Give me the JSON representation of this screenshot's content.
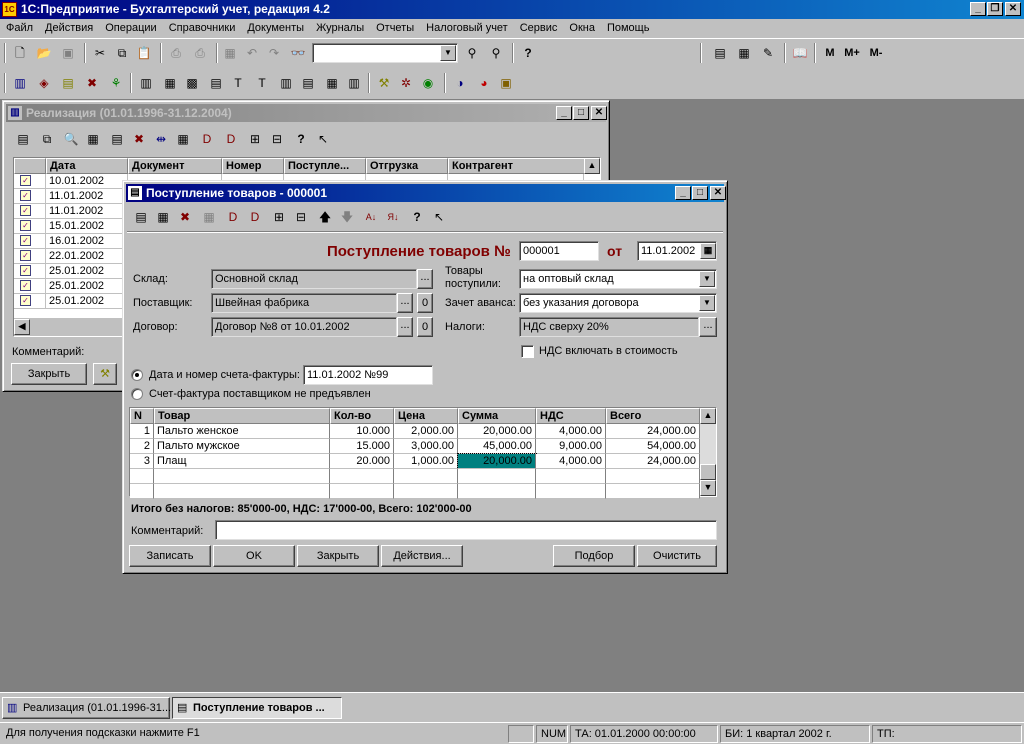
{
  "app": {
    "title": "1С:Предприятие - Бухгалтерский учет, редакция 4.2",
    "menu": [
      "Файл",
      "Действия",
      "Операции",
      "Справочники",
      "Документы",
      "Журналы",
      "Отчеты",
      "Налоговый учет",
      "Сервис",
      "Окна",
      "Помощь"
    ],
    "memory_buttons": [
      "M",
      "M+",
      "M-"
    ]
  },
  "realizacia": {
    "title": "Реализация (01.01.1996-31.12.2004)",
    "columns": [
      "Дата",
      "Документ",
      "Номер",
      "Поступле...",
      "Отгрузка",
      "Контрагент"
    ],
    "dates": [
      "10.01.2002",
      "11.01.2002",
      "11.01.2002",
      "15.01.2002",
      "16.01.2002",
      "22.01.2002",
      "25.01.2002",
      "25.01.2002",
      "25.01.2002"
    ],
    "comment_label": "Комментарий:",
    "close_button": "Закрыть"
  },
  "doc": {
    "window_title": "Поступление товаров - 000001",
    "heading": "Поступление товаров №",
    "number": "000001",
    "from_label": "от",
    "date": "11.01.2002",
    "sklad_label": "Склад:",
    "sklad_value": "Основной склад",
    "postavshik_label": "Поставщик:",
    "postavshik_value": "Швейная фабрика",
    "dogovor_label": "Договор:",
    "dogovor_value": "Договор №8 от 10.01.2002",
    "tovary_label_1": "Товары",
    "tovary_label_2": "поступили:",
    "tovary_value": "на оптовый склад",
    "zachet_label": "Зачет аванса:",
    "zachet_value": "без указания договора",
    "nalogi_label": "Налоги:",
    "nalogi_value": "НДС сверху 20%",
    "nds_checkbox_label": "НДС включать в стоимость",
    "radio1_label": "Дата и номер счета-фактуры:",
    "radio1_value": "11.01.2002 №99",
    "radio2_label": "Счет-фактура поставщиком не предъявлен",
    "ellipsis": "...",
    "zero": "0",
    "table": {
      "columns": [
        "N",
        "Товар",
        "Кол-во",
        "Цена",
        "Сумма",
        "НДС",
        "Всего"
      ],
      "rows": [
        {
          "n": "1",
          "tovar": "Пальто женское",
          "kol": "10.000",
          "cena": "2,000.00",
          "summa": "20,000.00",
          "nds": "4,000.00",
          "vsego": "24,000.00"
        },
        {
          "n": "2",
          "tovar": "Пальто мужское",
          "kol": "15.000",
          "cena": "3,000.00",
          "summa": "45,000.00",
          "nds": "9,000.00",
          "vsego": "54,000.00"
        },
        {
          "n": "3",
          "tovar": "Плащ",
          "kol": "20.000",
          "cena": "1,000.00",
          "summa": "20,000.00",
          "nds": "4,000.00",
          "vsego": "24,000.00"
        }
      ]
    },
    "totals": "Итого без налогов: 85'000-00, НДС: 17'000-00, Всего: 102'000-00",
    "comment_label": "Комментарий:",
    "buttons": {
      "zapisat": "Записать",
      "ok": "OK",
      "zakryt": "Закрыть",
      "deystviya": "Действия...",
      "podbor": "Подбор",
      "ochistit": "Очистить"
    }
  },
  "taskbar": {
    "items": [
      "Реализация (01.01.1996-31...",
      "Поступление товаров ..."
    ]
  },
  "status": {
    "hint": "Для получения подсказки нажмите F1",
    "num": "NUM",
    "ta": "ТА: 01.01.2000  00:00:00",
    "bi": "БИ: 1 квартал 2002 г.",
    "tp": "ТП:"
  },
  "colors": {
    "title_active": "#000080",
    "desktop": "#808080",
    "face": "#c0c0c0",
    "heading_red": "#800000",
    "selected_cell": "#008080"
  }
}
